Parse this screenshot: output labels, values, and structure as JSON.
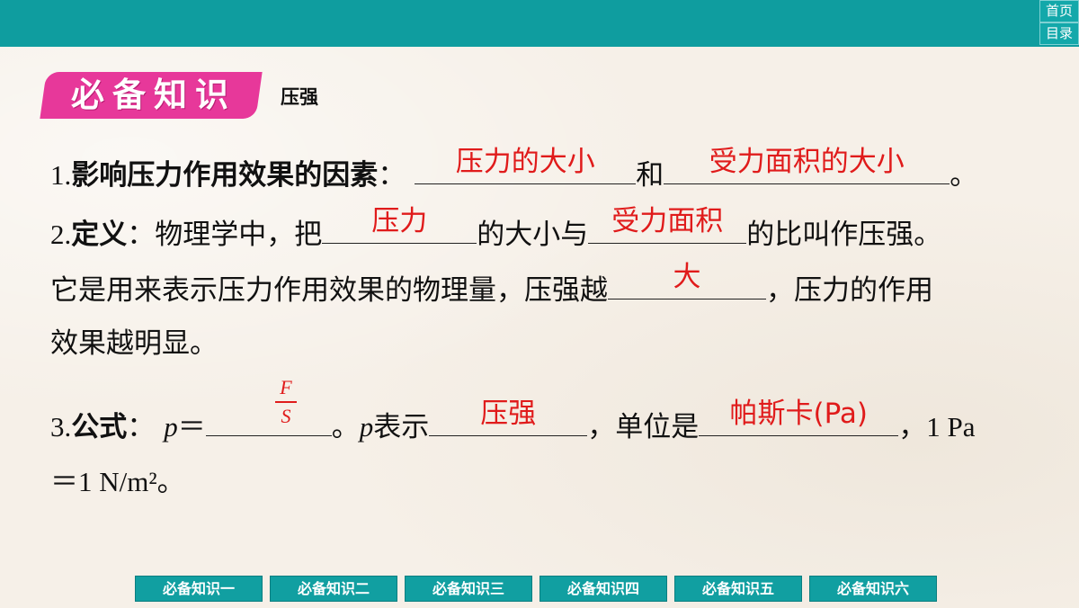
{
  "top_nav": {
    "home_label": "首页",
    "toc_label": "目录"
  },
  "section": {
    "badge": "必备知识",
    "topic": "压强"
  },
  "item1": {
    "num": "1.",
    "term": "影响压力作用效果的因素",
    "colon": "：",
    "answer1": "压力的大小",
    "connector": "和",
    "answer2": "受力面积的大小",
    "end": "。"
  },
  "item2": {
    "num": "2.",
    "term": "定义",
    "text1": "：物理学中，把",
    "answer1": "压力",
    "text2": "的大小与",
    "answer2": "受力面积",
    "text3": "的比叫作压强。",
    "text4": "它是用来表示压力作用效果的物理量，压强越",
    "answer3": "大",
    "text5": "，压力的作用",
    "text6": "效果越明显。"
  },
  "item3": {
    "num": "3.",
    "term": "公式",
    "colon": "：",
    "var_p": "p",
    "eq": "＝",
    "frac_num": "F",
    "frac_den": "S",
    "text1": "。",
    "var_p2": "p",
    "text2": "表示",
    "answer1": "压强",
    "text3": "，单位是",
    "answer2": "帕斯卡(Pa)",
    "text4": "，1 Pa",
    "text5": "＝1 N/m²。"
  },
  "bottom_nav": [
    "必备知识一",
    "必备知识二",
    "必备知识三",
    "必备知识四",
    "必备知识五",
    "必备知识六"
  ],
  "colors": {
    "teal": "#0f9d9f",
    "pink_badge": "#e7389a",
    "answer_red": "#e01b1b"
  }
}
